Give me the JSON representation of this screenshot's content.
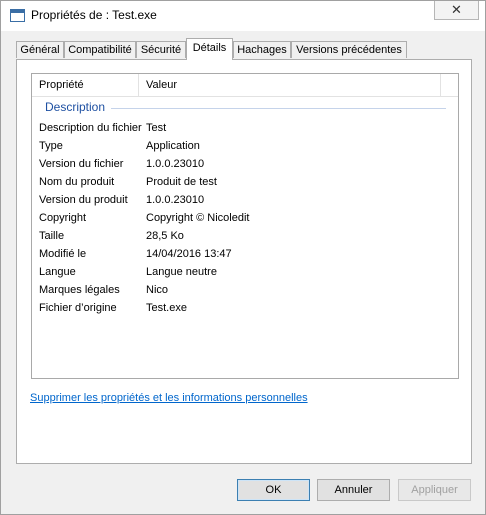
{
  "window": {
    "title": "Propriétés de : Test.exe",
    "close_glyph": "✕"
  },
  "tabs": [
    "Général",
    "Compatibilité",
    "Sécurité",
    "Détails",
    "Hachages",
    "Versions précédentes"
  ],
  "active_tab": "Détails",
  "list": {
    "col_property": "Propriété",
    "col_value": "Valeur",
    "group": "Description",
    "rows": [
      {
        "p": "Description du fichier",
        "v": "Test"
      },
      {
        "p": "Type",
        "v": "Application"
      },
      {
        "p": "Version du fichier",
        "v": "1.0.0.23010"
      },
      {
        "p": "Nom du produit",
        "v": "Produit de test"
      },
      {
        "p": "Version du produit",
        "v": "1.0.0.23010"
      },
      {
        "p": "Copyright",
        "v": "Copyright © Nicoledit"
      },
      {
        "p": "Taille",
        "v": "28,5 Ko"
      },
      {
        "p": "Modifié le",
        "v": "14/04/2016 13:47"
      },
      {
        "p": "Langue",
        "v": "Langue neutre"
      },
      {
        "p": "Marques légales",
        "v": "Nico"
      },
      {
        "p": "Fichier d’origine",
        "v": "Test.exe"
      }
    ]
  },
  "link": "Supprimer les propriétés et les informations personnelles",
  "buttons": {
    "ok": "OK",
    "cancel": "Annuler",
    "apply": "Appliquer"
  },
  "colors": {
    "link": "#0066cc",
    "group_header": "#1e50a2"
  },
  "icons": {
    "title": "window-icon",
    "close": "close-icon"
  }
}
